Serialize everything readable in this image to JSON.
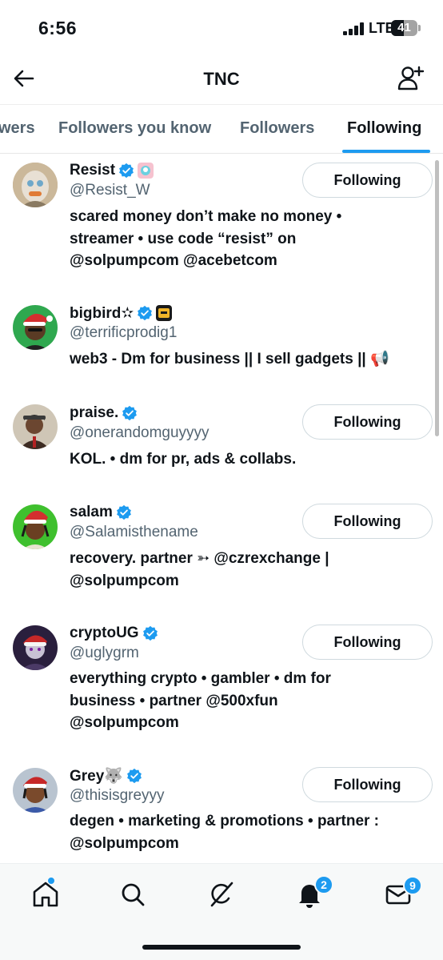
{
  "status_bar": {
    "time": "6:56",
    "network": "LTE",
    "battery": "41"
  },
  "header": {
    "title": "TNC",
    "back_icon": "arrow-left-icon",
    "add_icon": "add-user-icon"
  },
  "tabs": [
    {
      "label": "wers",
      "active": false
    },
    {
      "label": "Followers you know",
      "active": false
    },
    {
      "label": "Followers",
      "active": false
    },
    {
      "label": "Following",
      "active": true
    }
  ],
  "users": [
    {
      "name": "Resist",
      "handle": "@Resist_W",
      "verified": true,
      "button": "Following",
      "bio": [
        "scared money don’t make no money •",
        "streamer • use code “resist” on",
        "@solpumpcom @acebetcom"
      ]
    },
    {
      "name": "bigbird✫",
      "handle": "@terrificprodig1",
      "verified": true,
      "button": "",
      "bio": [
        "web3 - Dm for business || I sell gadgets || 📢"
      ]
    },
    {
      "name": "praise.",
      "handle": "@onerandomguyyyy",
      "verified": true,
      "button": "Following",
      "bio": [
        "KOL. • dm for pr, ads & collabs."
      ]
    },
    {
      "name": "salam",
      "handle": "@Salamisthename",
      "verified": true,
      "button": "Following",
      "bio": [
        "recovery. partner ➳ @czrexchange |",
        "@solpumpcom"
      ]
    },
    {
      "name": "cryptoUG",
      "handle": "@uglygrm",
      "verified": true,
      "button": "Following",
      "bio": [
        "everything crypto • gambler • dm for",
        "business • partner @500xfun",
        "@solpumpcom"
      ]
    },
    {
      "name": "Grey🐺",
      "handle": "@thisisgreyyy",
      "verified": true,
      "button": "Following",
      "bio": [
        "degen • marketing & promotions • partner :",
        "@solpumpcom"
      ]
    }
  ],
  "bottom_nav": {
    "items": [
      "home-icon",
      "search-icon",
      "grok-icon",
      "notifications-icon",
      "messages-icon"
    ],
    "notifications_badge": "2",
    "messages_badge": "9"
  },
  "colors": {
    "accent": "#1d9bf0",
    "text": "#0f1419",
    "secondary": "#536471",
    "border": "#cfd9de"
  }
}
